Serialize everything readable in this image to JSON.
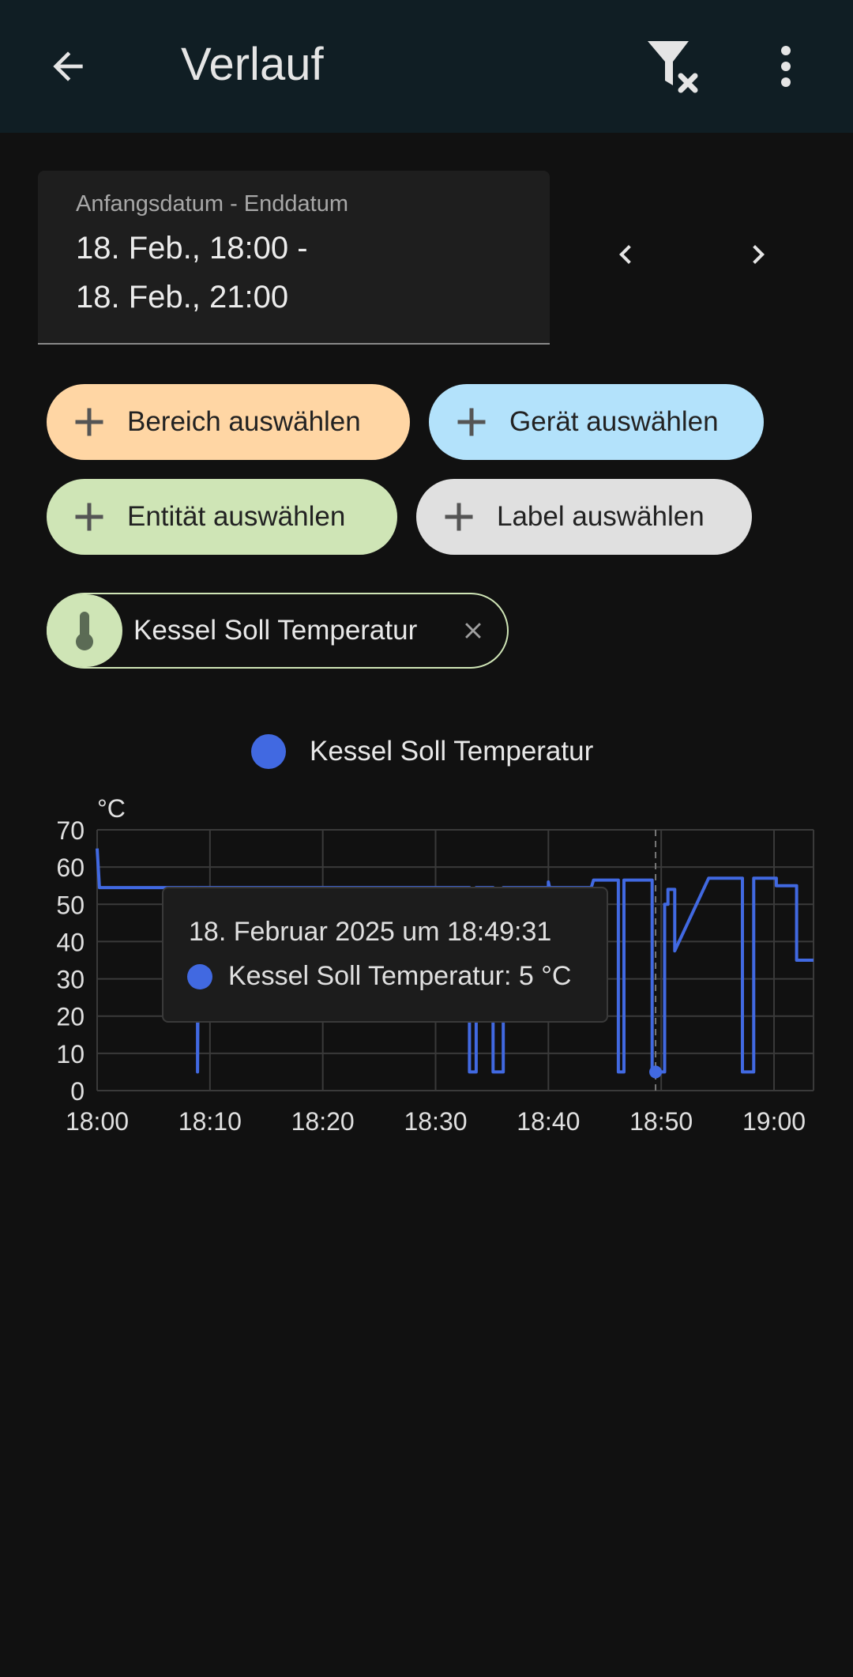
{
  "appbar": {
    "title": "Verlauf"
  },
  "date_range": {
    "label": "Anfangsdatum - Enddatum",
    "line1": "18. Feb., 18:00 -",
    "line2": "18. Feb., 21:00"
  },
  "chips": {
    "bereich": "Bereich auswählen",
    "geraet": "Gerät auswählen",
    "entitaet": "Entität auswählen",
    "label": "Label auswählen"
  },
  "selected": {
    "label": "Kessel Soll Temperatur"
  },
  "colors": {
    "series": "#4169e1",
    "chip_orange": "#ffd6a4",
    "chip_blue": "#b3e2fb",
    "chip_green": "#cfe5b6",
    "chip_grey": "#e0e0e0"
  },
  "tooltip": {
    "date": "18. Februar 2025 um 18:49:31",
    "value": "Kessel Soll Temperatur: 5 °C"
  },
  "chart_data": {
    "type": "line",
    "ylabel": "°C",
    "ylim": [
      0,
      70
    ],
    "yticks": [
      "0",
      "10",
      "20",
      "30",
      "40",
      "50",
      "60",
      "70"
    ],
    "xticks": [
      "18:00",
      "18:10",
      "18:20",
      "18:30",
      "18:40",
      "18:50",
      "19:00"
    ],
    "xlim_minutes": [
      0,
      63.5
    ],
    "grid": true,
    "legend": "top-center",
    "series": [
      {
        "name": "Kessel Soll Temperatur",
        "step": true,
        "points": [
          [
            0,
            65
          ],
          [
            0.2,
            54.5
          ],
          [
            8.9,
            54.5
          ],
          [
            8.9,
            5
          ],
          [
            9.0,
            54.5
          ],
          [
            33.0,
            54.5
          ],
          [
            33.0,
            5
          ],
          [
            33.6,
            5
          ],
          [
            33.6,
            54.5
          ],
          [
            35.1,
            54.5
          ],
          [
            35.1,
            5
          ],
          [
            36.0,
            5
          ],
          [
            36.0,
            54.5
          ],
          [
            40.0,
            54.5
          ],
          [
            40.0,
            56
          ],
          [
            40.1,
            54.5
          ],
          [
            43.8,
            54.5
          ],
          [
            44.0,
            56.5
          ],
          [
            46.2,
            56.5
          ],
          [
            46.2,
            5
          ],
          [
            46.7,
            5
          ],
          [
            46.7,
            56.5
          ],
          [
            49.2,
            56.5
          ],
          [
            49.2,
            5
          ],
          [
            50.3,
            5
          ],
          [
            50.3,
            50
          ],
          [
            50.6,
            50
          ],
          [
            50.6,
            54
          ],
          [
            51.2,
            54
          ],
          [
            51.2,
            37.5
          ],
          [
            54.2,
            57
          ],
          [
            57.2,
            57
          ],
          [
            57.2,
            5
          ],
          [
            58.2,
            5
          ],
          [
            58.2,
            57
          ],
          [
            60.2,
            57
          ],
          [
            60.2,
            55
          ],
          [
            62.0,
            55
          ],
          [
            62.0,
            35
          ],
          [
            63.5,
            35
          ]
        ]
      }
    ],
    "highlight": {
      "x": 49.5,
      "y": 5
    }
  }
}
